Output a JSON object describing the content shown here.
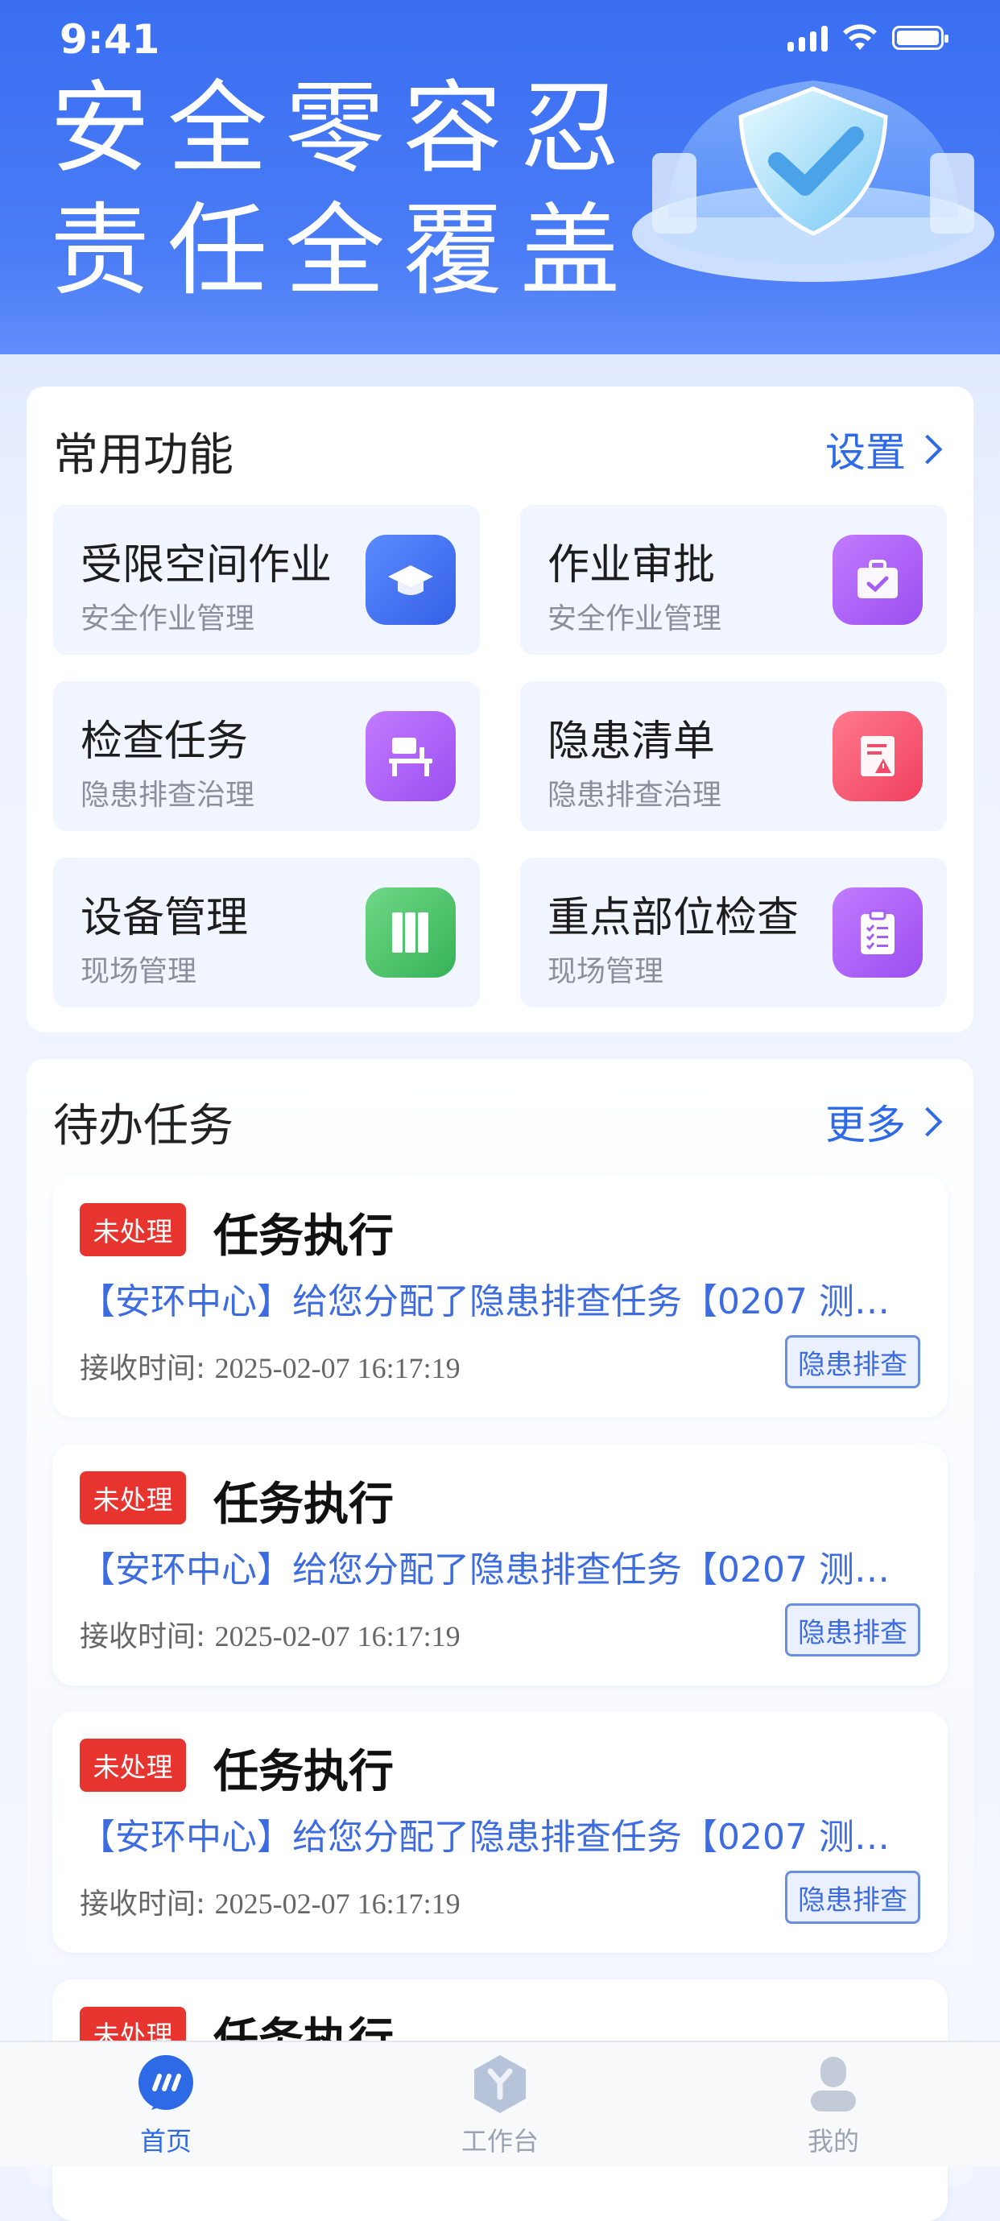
{
  "status": {
    "time": "9:41"
  },
  "hero": {
    "line1": "安全零容忍",
    "line2": "责任全覆盖"
  },
  "functions": {
    "title": "常用功能",
    "settings_label": "设置",
    "items": [
      {
        "title": "受限空间作业",
        "subtitle": "安全作业管理",
        "icon": "graduation-cap-icon",
        "color": "#3f6ff0"
      },
      {
        "title": "作业审批",
        "subtitle": "安全作业管理",
        "icon": "briefcase-check-icon",
        "color": "#a55ff0"
      },
      {
        "title": "检查任务",
        "subtitle": "隐患排查治理",
        "icon": "workstation-icon",
        "color": "#a55ff0"
      },
      {
        "title": "隐患清单",
        "subtitle": "隐患排查治理",
        "icon": "warning-document-icon",
        "color": "#f04d6a"
      },
      {
        "title": "设备管理",
        "subtitle": "现场管理",
        "icon": "binders-icon",
        "color": "#3fbf5f"
      },
      {
        "title": "重点部位检查",
        "subtitle": "现场管理",
        "icon": "clipboard-checklist-icon",
        "color": "#a55ff0"
      }
    ]
  },
  "todo": {
    "title": "待办任务",
    "more_label": "更多",
    "tasks": [
      {
        "status": "未处理",
        "title": "任务执行",
        "desc": "【安环中心】给您分配了隐患排查任务【0207 测…",
        "time_label": "接收时间:",
        "time": "2025-02-07 16:17:19",
        "tag": "隐患排查"
      },
      {
        "status": "未处理",
        "title": "任务执行",
        "desc": "【安环中心】给您分配了隐患排查任务【0207 测…",
        "time_label": "接收时间:",
        "time": "2025-02-07 16:17:19",
        "tag": "隐患排查"
      },
      {
        "status": "未处理",
        "title": "任务执行",
        "desc": "【安环中心】给您分配了隐患排查任务【0207 测…",
        "time_label": "接收时间:",
        "time": "2025-02-07 16:17:19",
        "tag": "隐患排查"
      },
      {
        "status": "未处理",
        "title": "任务执行"
      }
    ]
  },
  "tabbar": {
    "items": [
      {
        "label": "首页",
        "icon": "chat-bubble-icon",
        "active": true,
        "color": "#2f6ae6"
      },
      {
        "label": "工作台",
        "icon": "hexagon-y-icon",
        "active": false,
        "color": "#9aa3b2"
      },
      {
        "label": "我的",
        "icon": "user-icon",
        "active": false,
        "color": "#9aa3b2"
      }
    ]
  }
}
